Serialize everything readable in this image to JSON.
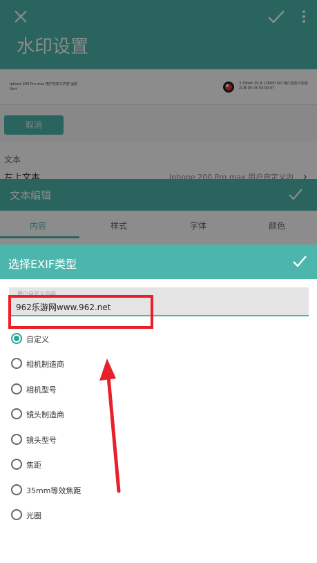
{
  "main": {
    "title": "水印设置",
    "preview_left_text": "Iphone 200 Pro max 用户自定义内容 @彩 Ilovr",
    "preview_right_text": "3.79mm f/1.8 1/3000 ISO 用户自定义内容 21年 05 05 03:00 07",
    "background_button": "取消",
    "section_label": "文本",
    "text_row_label": "左上文本",
    "text_row_value": "Iphone 200 Pro max 用户自定义内容"
  },
  "edit_sheet": {
    "title": "文本编辑",
    "tabs": [
      "内容",
      "样式",
      "字体",
      "颜色"
    ]
  },
  "dialog": {
    "title": "选择EXIF类型",
    "field_hint": "用户自定义内容",
    "field_value": "962乐游网www.962.net",
    "options": [
      "自定义",
      "相机制造商",
      "相机型号",
      "镜头制造商",
      "镜头型号",
      "焦距",
      "35mm等效焦距",
      "光圈"
    ],
    "selected_index": 0
  },
  "colors": {
    "accent": "#4db6ac",
    "radio_checked": "#26a69a",
    "annotation_red": "#e8202a"
  },
  "icons": [
    "close-icon",
    "check-icon",
    "more-vert-icon",
    "chevron-right-icon",
    "logo-icon"
  ]
}
